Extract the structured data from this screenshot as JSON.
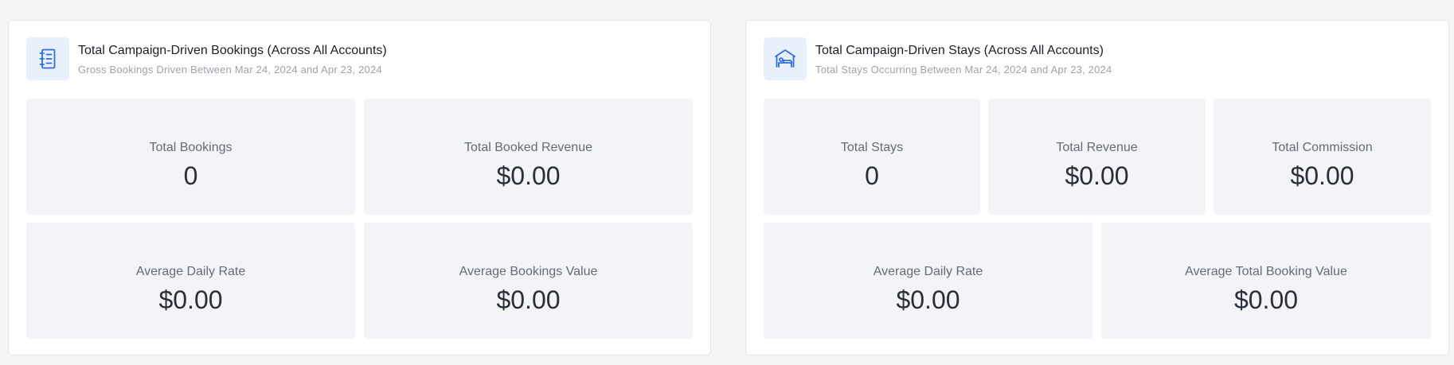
{
  "bookings_card": {
    "icon": "notebook-list-icon",
    "title": "Total Campaign-Driven Bookings (Across All Accounts)",
    "subtitle": "Gross Bookings Driven Between Mar 24, 2024 and Apr 23, 2024",
    "metrics": [
      {
        "label": "Total Bookings",
        "value": "0"
      },
      {
        "label": "Total Booked Revenue",
        "value": "$0.00"
      },
      {
        "label": "Average Daily Rate",
        "value": "$0.00"
      },
      {
        "label": "Average Bookings Value",
        "value": "$0.00"
      }
    ]
  },
  "stays_card": {
    "icon": "hotel-bed-icon",
    "title": "Total Campaign-Driven Stays (Across All Accounts)",
    "subtitle": "Total Stays Occurring Between Mar 24, 2024 and Apr 23, 2024",
    "metrics": [
      {
        "label": "Total Stays",
        "value": "0"
      },
      {
        "label": "Total Revenue",
        "value": "$0.00"
      },
      {
        "label": "Total Commission",
        "value": "$0.00"
      },
      {
        "label": "Average Daily Rate",
        "value": "$0.00"
      },
      {
        "label": "Average Total Booking Value",
        "value": "$0.00"
      }
    ]
  },
  "colors": {
    "accent": "#2f6de3",
    "icon_bg": "#e9f0fd",
    "tile_bg": "#f3f4f8",
    "page_bg": "#f4f5f7"
  }
}
